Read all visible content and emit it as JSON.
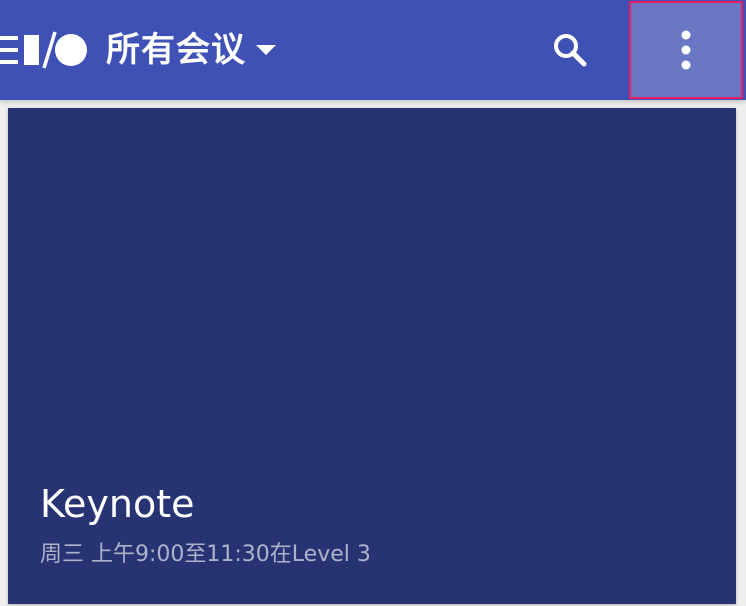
{
  "app": {
    "icons": {
      "logo": "google-io-logo",
      "search": "search-icon",
      "overflow": "more-vert-icon",
      "dropdown": "caret-down-icon"
    },
    "colors": {
      "primary": "#3f51b5",
      "card": "#283373",
      "highlight_border": "#e91e63",
      "background": "#eeeeee"
    }
  },
  "toolbar": {
    "title": "所有会议"
  },
  "session_card": {
    "title": "Keynote",
    "subtitle": "周三 上午9:00至11:30在Level 3"
  }
}
